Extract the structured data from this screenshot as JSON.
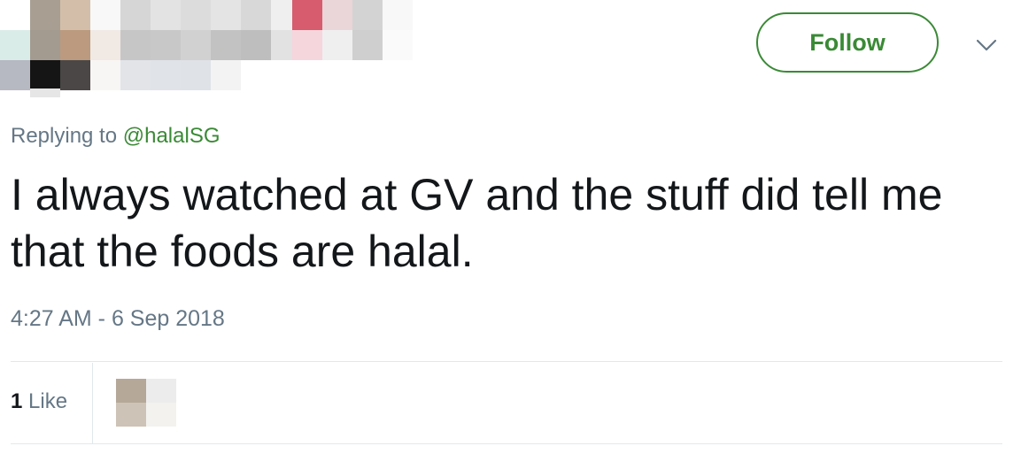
{
  "header": {
    "follow_label": "Follow",
    "caret_icon": "chevron-down-icon"
  },
  "reply_context": {
    "prefix": "Replying to",
    "handle": "@halalSG"
  },
  "tweet": {
    "text": "I always watched at GV and the stuff did tell me that the foods are halal.",
    "timestamp": "4:27 AM - 6 Sep 2018"
  },
  "stats": {
    "likes_count": "1",
    "likes_label": "Like"
  },
  "colors": {
    "accent": "#3a8a35",
    "muted_text": "#657786",
    "main_text": "#14171a",
    "divider": "#e1e8ed"
  }
}
